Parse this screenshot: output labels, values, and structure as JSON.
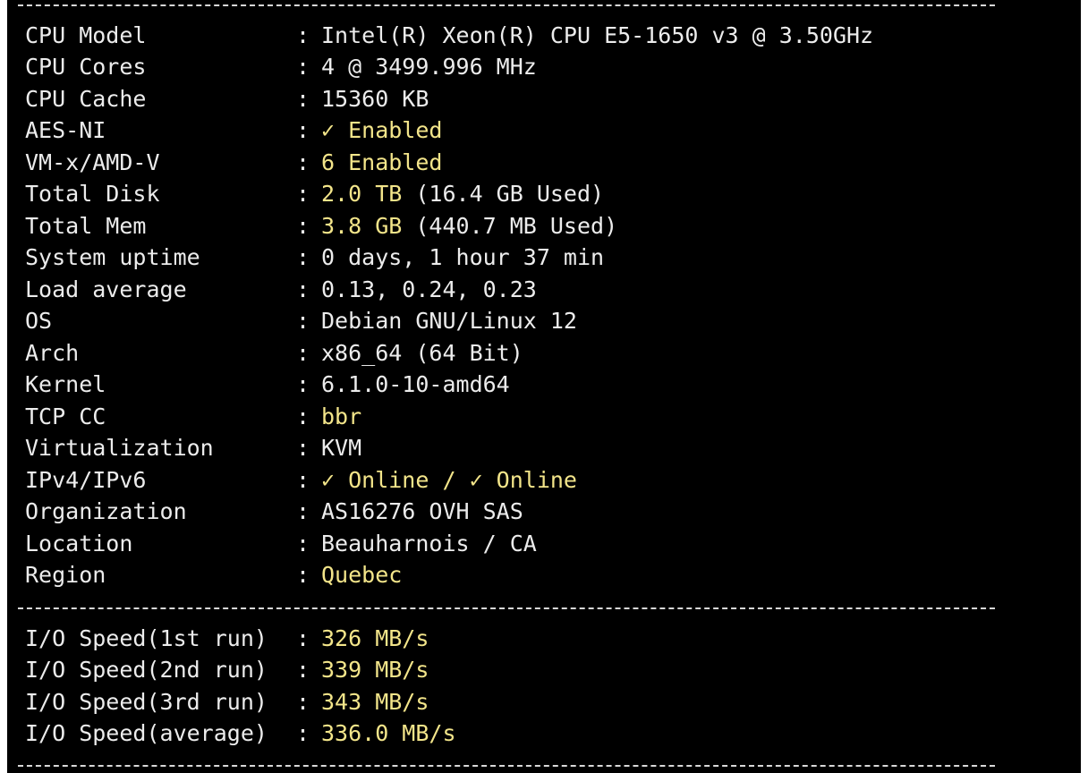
{
  "colors": {
    "background": "#000000",
    "text": "#ececec",
    "highlight": "#f3e58a"
  },
  "system_info": [
    {
      "label": "CPU Model",
      "value": "Intel(R) Xeon(R) CPU E5-1650 v3 @ 3.50GHz",
      "extra": ""
    },
    {
      "label": "CPU Cores",
      "value": "4 @ 3499.996 MHz",
      "extra": ""
    },
    {
      "label": "CPU Cache",
      "value": "15360 KB",
      "extra": ""
    },
    {
      "label": "AES-NI",
      "value": "✓ Enabled",
      "extra": ""
    },
    {
      "label": "VM-x/AMD-V",
      "value": "6 Enabled",
      "extra": ""
    },
    {
      "label": "Total Disk",
      "value": "2.0 TB",
      "extra": " (16.4 GB Used)"
    },
    {
      "label": "Total Mem",
      "value": "3.8 GB",
      "extra": " (440.7 MB Used)"
    },
    {
      "label": "System uptime",
      "value": "0 days, 1 hour 37 min",
      "extra": ""
    },
    {
      "label": "Load average",
      "value": "0.13, 0.24, 0.23",
      "extra": ""
    },
    {
      "label": "OS",
      "value": "Debian GNU/Linux 12",
      "extra": ""
    },
    {
      "label": "Arch",
      "value": "x86_64 (64 Bit)",
      "extra": ""
    },
    {
      "label": "Kernel",
      "value": "6.1.0-10-amd64",
      "extra": ""
    },
    {
      "label": "TCP CC",
      "value": "bbr",
      "extra": ""
    },
    {
      "label": "Virtualization",
      "value": "KVM",
      "extra": ""
    },
    {
      "label": "IPv4/IPv6",
      "value": "✓ Online / ✓ Online",
      "extra": ""
    },
    {
      "label": "Organization",
      "value": "AS16276 OVH SAS",
      "extra": ""
    },
    {
      "label": "Location",
      "value": "Beauharnois / CA",
      "extra": ""
    },
    {
      "label": "Region",
      "value": "Quebec",
      "extra": ""
    }
  ],
  "io_speed": [
    {
      "label": "I/O Speed(1st run)",
      "value": "326 MB/s"
    },
    {
      "label": "I/O Speed(2nd run)",
      "value": "339 MB/s"
    },
    {
      "label": "I/O Speed(3rd run)",
      "value": "343 MB/s"
    },
    {
      "label": "I/O Speed(average)",
      "value": "336.0 MB/s"
    }
  ],
  "colon": ":"
}
